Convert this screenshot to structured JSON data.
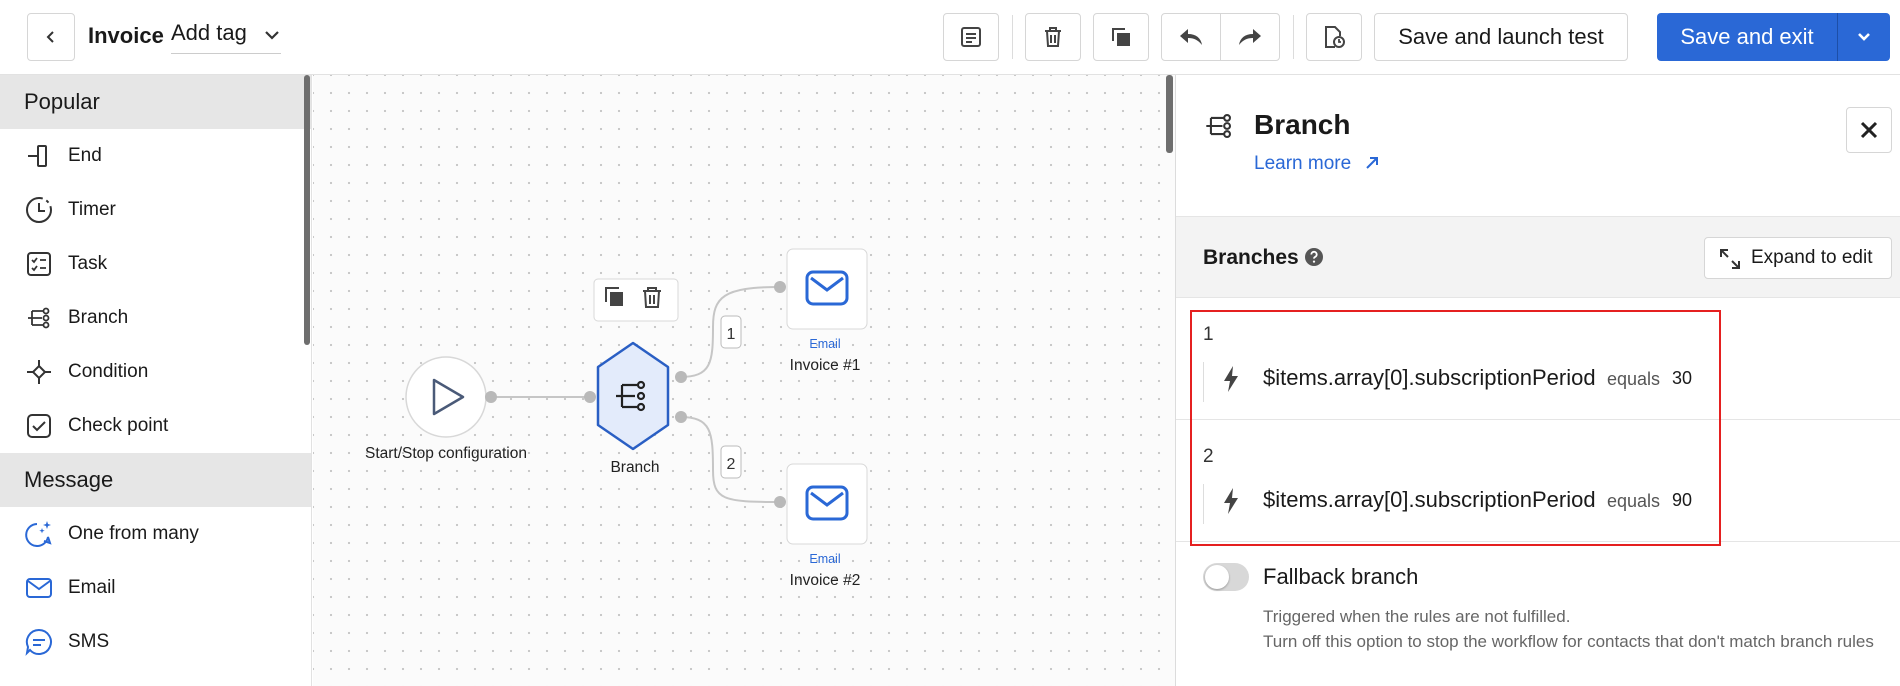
{
  "topbar": {
    "title": "Invoice",
    "tag_label": "Add tag",
    "launch_label": "Save and launch test",
    "save_label": "Save and exit"
  },
  "sidebar": {
    "sections": [
      {
        "title": "Popular",
        "items": [
          {
            "label": "End",
            "icon": "end-icon"
          },
          {
            "label": "Timer",
            "icon": "timer-icon"
          },
          {
            "label": "Task",
            "icon": "task-icon"
          },
          {
            "label": "Branch",
            "icon": "branch-icon"
          },
          {
            "label": "Condition",
            "icon": "condition-icon"
          },
          {
            "label": "Check point",
            "icon": "check-point-icon"
          }
        ]
      },
      {
        "title": "Message",
        "items": [
          {
            "label": "One from many",
            "icon": "one-from-many-icon"
          },
          {
            "label": "Email",
            "icon": "email-icon"
          },
          {
            "label": "SMS",
            "icon": "sms-icon"
          }
        ]
      }
    ]
  },
  "canvas": {
    "start_label": "Start/Stop configuration",
    "branch_label": "Branch",
    "edge_1": "1",
    "edge_2": "2",
    "email_1": {
      "type": "Email",
      "name": "Invoice #1"
    },
    "email_2": {
      "type": "Email",
      "name": "Invoice #2"
    }
  },
  "panel": {
    "title": "Branch",
    "learn_more": "Learn more",
    "branches_title": "Branches",
    "expand_label": "Expand to edit",
    "rules": [
      {
        "number": "1",
        "path": "$items.array[0].subscriptionPeriod",
        "operator": "equals",
        "value": "30"
      },
      {
        "number": "2",
        "path": "$items.array[0].subscriptionPeriod",
        "operator": "equals",
        "value": "90"
      }
    ],
    "fallback": {
      "title": "Fallback branch",
      "enabled": false,
      "line1": "Triggered when the rules are not fulfilled.",
      "line2": "Turn off this option to stop the workflow for contacts that don't match branch rules"
    }
  },
  "colors": {
    "accent": "#2a68d6",
    "highlight": "#e52020",
    "node_fill": "#e3ebfb"
  }
}
